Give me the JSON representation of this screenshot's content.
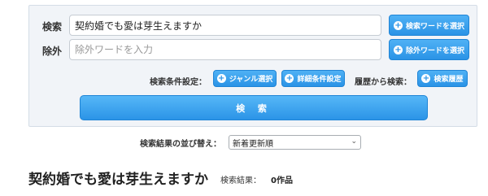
{
  "search_form": {
    "keyword_label": "検索",
    "keyword_value": "契約婚でも愛は芽生えますか",
    "keyword_button": "検索ワードを選択",
    "exclude_label": "除外",
    "exclude_placeholder": "除外ワードを入力",
    "exclude_button": "除外ワードを選択",
    "conditions_label": "検索条件設定：",
    "genre_button": "ジャンル選択",
    "detail_button": "詳細条件設定",
    "history_label": "履歴から検索：",
    "history_button": "検索履歴",
    "submit_label": "検 索"
  },
  "sort": {
    "label": "検索結果の並び替え：",
    "selected": "新着更新順"
  },
  "results": {
    "title": "契約婚でも愛は芽生えますか",
    "meta_label": "検索結果：",
    "count": "0作品"
  },
  "colors": {
    "accent": "#2a93e6",
    "panel_bg": "#f1f4f8"
  },
  "icons": {
    "add": "plus-circle-icon",
    "dropdown": "chevron-down-icon"
  }
}
